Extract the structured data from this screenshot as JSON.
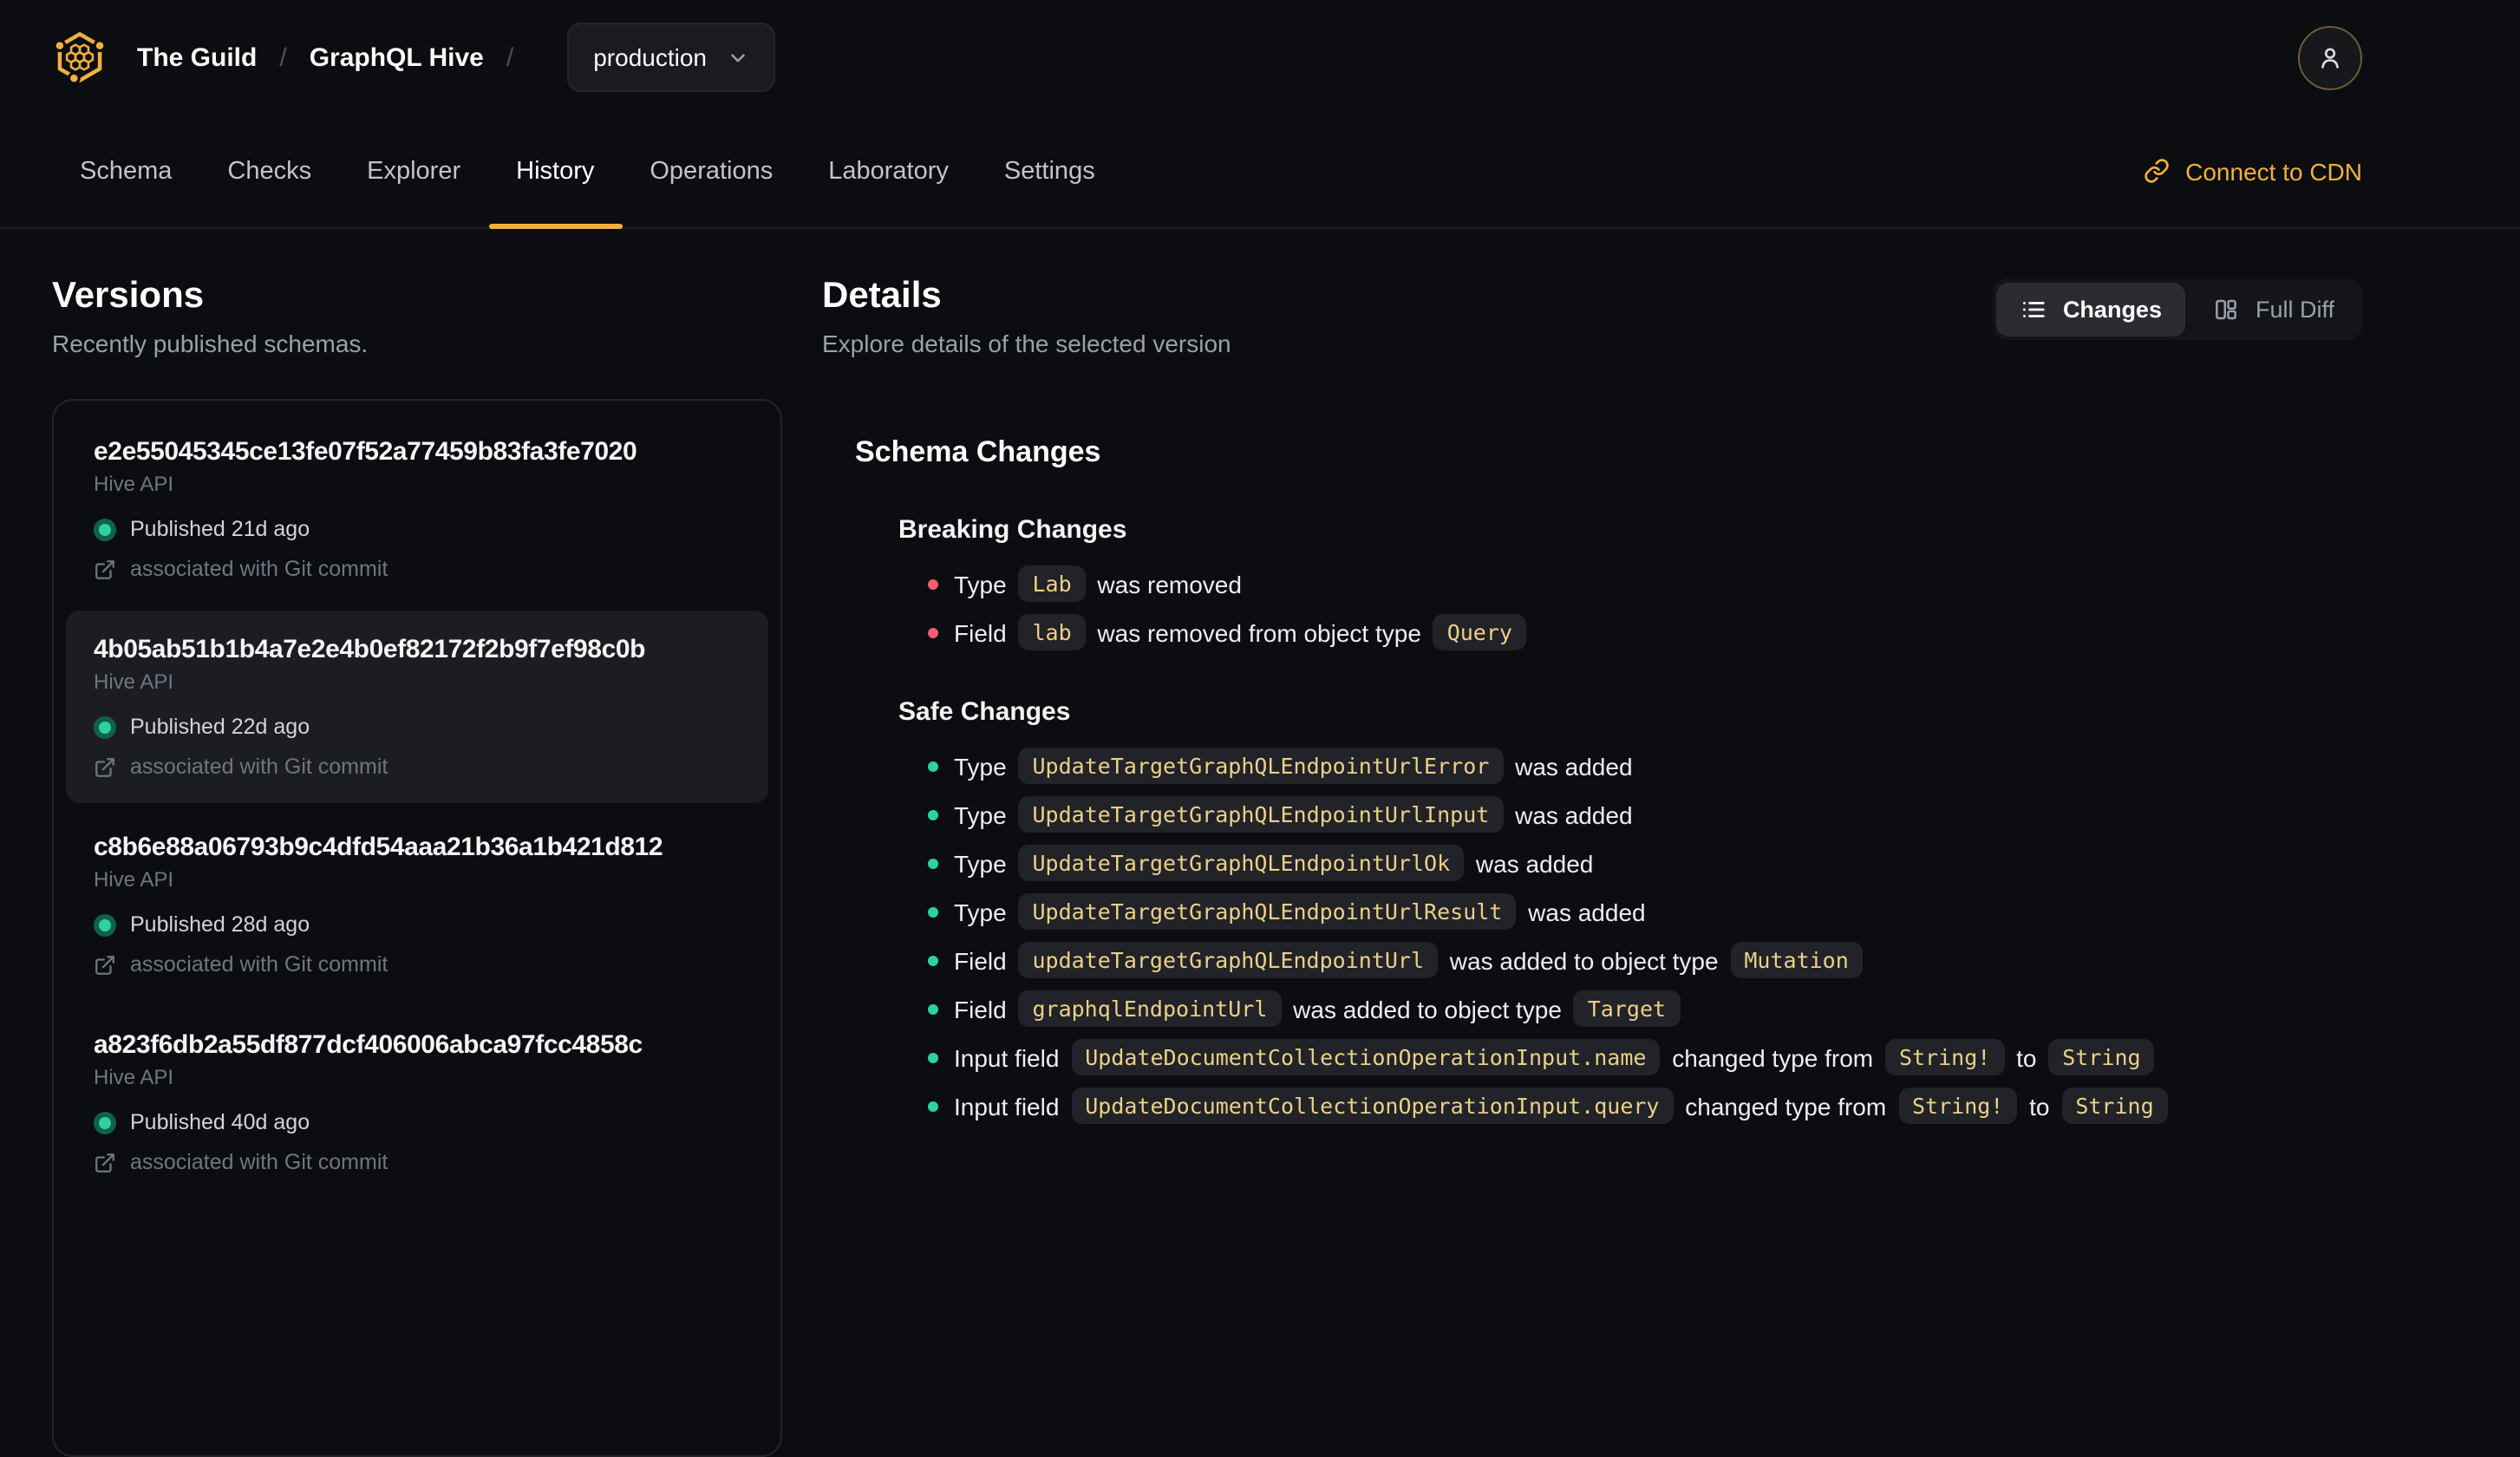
{
  "colors": {
    "accent": "#f0b13e",
    "page_bg": "#0b0d11",
    "breaking_bullet": "#ef5f6f",
    "safe_bullet": "#2ad49e",
    "published_dot": "#2fd29c",
    "code_text": "#ecd086"
  },
  "header": {
    "org": "The Guild",
    "separator": "/",
    "project": "GraphQL Hive",
    "target": "production",
    "icons": {
      "logo": "hive-honeycomb-logo",
      "target_chevron": "chevron-down-icon",
      "avatar": "user-icon"
    }
  },
  "nav": {
    "tabs": [
      {
        "label": "Schema",
        "active": false
      },
      {
        "label": "Checks",
        "active": false
      },
      {
        "label": "Explorer",
        "active": false
      },
      {
        "label": "History",
        "active": true
      },
      {
        "label": "Operations",
        "active": false
      },
      {
        "label": "Laboratory",
        "active": false
      },
      {
        "label": "Settings",
        "active": false
      }
    ],
    "connect_cdn": "Connect to CDN",
    "connect_cdn_icon": "link-icon"
  },
  "versions": {
    "title": "Versions",
    "subtitle": "Recently published schemas.",
    "items": [
      {
        "hash": "e2e55045345ce13fe07f52a77459b83fa3fe7020",
        "service": "Hive API",
        "published": "Published 21d ago",
        "git": "associated with Git commit",
        "selected": false
      },
      {
        "hash": "4b05ab51b1b4a7e2e4b0ef82172f2b9f7ef98c0b",
        "service": "Hive API",
        "published": "Published 22d ago",
        "git": "associated with Git commit",
        "selected": true
      },
      {
        "hash": "c8b6e88a06793b9c4dfd54aaa21b36a1b421d812",
        "service": "Hive API",
        "published": "Published 28d ago",
        "git": "associated with Git commit",
        "selected": false
      },
      {
        "hash": "a823f6db2a55df877dcf406006abca97fcc4858c",
        "service": "Hive API",
        "published": "Published 40d ago",
        "git": "associated with Git commit",
        "selected": false
      }
    ]
  },
  "details": {
    "title": "Details",
    "subtitle": "Explore details of the selected version",
    "view_toggle": {
      "changes": "Changes",
      "full_diff": "Full Diff",
      "active": "Changes",
      "changes_icon": "list-icon",
      "full_diff_icon": "columns-icon"
    },
    "section_title": "Schema Changes",
    "groups": [
      {
        "title": "Breaking Changes",
        "severity": "breaking",
        "items": [
          [
            {
              "t": "text",
              "v": "Type "
            },
            {
              "t": "code",
              "v": "Lab"
            },
            {
              "t": "text",
              "v": " was removed"
            }
          ],
          [
            {
              "t": "text",
              "v": "Field "
            },
            {
              "t": "code",
              "v": "lab"
            },
            {
              "t": "text",
              "v": " was removed from object type "
            },
            {
              "t": "code",
              "v": "Query"
            }
          ]
        ]
      },
      {
        "title": "Safe Changes",
        "severity": "safe",
        "items": [
          [
            {
              "t": "text",
              "v": "Type "
            },
            {
              "t": "code",
              "v": "UpdateTargetGraphQLEndpointUrlError"
            },
            {
              "t": "text",
              "v": " was added"
            }
          ],
          [
            {
              "t": "text",
              "v": "Type "
            },
            {
              "t": "code",
              "v": "UpdateTargetGraphQLEndpointUrlInput"
            },
            {
              "t": "text",
              "v": " was added"
            }
          ],
          [
            {
              "t": "text",
              "v": "Type "
            },
            {
              "t": "code",
              "v": "UpdateTargetGraphQLEndpointUrlOk"
            },
            {
              "t": "text",
              "v": " was added"
            }
          ],
          [
            {
              "t": "text",
              "v": "Type "
            },
            {
              "t": "code",
              "v": "UpdateTargetGraphQLEndpointUrlResult"
            },
            {
              "t": "text",
              "v": " was added"
            }
          ],
          [
            {
              "t": "text",
              "v": "Field "
            },
            {
              "t": "code",
              "v": "updateTargetGraphQLEndpointUrl"
            },
            {
              "t": "text",
              "v": " was added to object type "
            },
            {
              "t": "code",
              "v": "Mutation"
            }
          ],
          [
            {
              "t": "text",
              "v": "Field "
            },
            {
              "t": "code",
              "v": "graphqlEndpointUrl"
            },
            {
              "t": "text",
              "v": " was added to object type "
            },
            {
              "t": "code",
              "v": "Target"
            }
          ],
          [
            {
              "t": "text",
              "v": "Input field "
            },
            {
              "t": "code",
              "v": "UpdateDocumentCollectionOperationInput.name"
            },
            {
              "t": "text",
              "v": " changed type from "
            },
            {
              "t": "code",
              "v": "String!"
            },
            {
              "t": "text",
              "v": " to "
            },
            {
              "t": "code",
              "v": "String"
            }
          ],
          [
            {
              "t": "text",
              "v": "Input field "
            },
            {
              "t": "code",
              "v": "UpdateDocumentCollectionOperationInput.query"
            },
            {
              "t": "text",
              "v": " changed type from "
            },
            {
              "t": "code",
              "v": "String!"
            },
            {
              "t": "text",
              "v": " to "
            },
            {
              "t": "code",
              "v": "String"
            }
          ]
        ]
      }
    ]
  }
}
